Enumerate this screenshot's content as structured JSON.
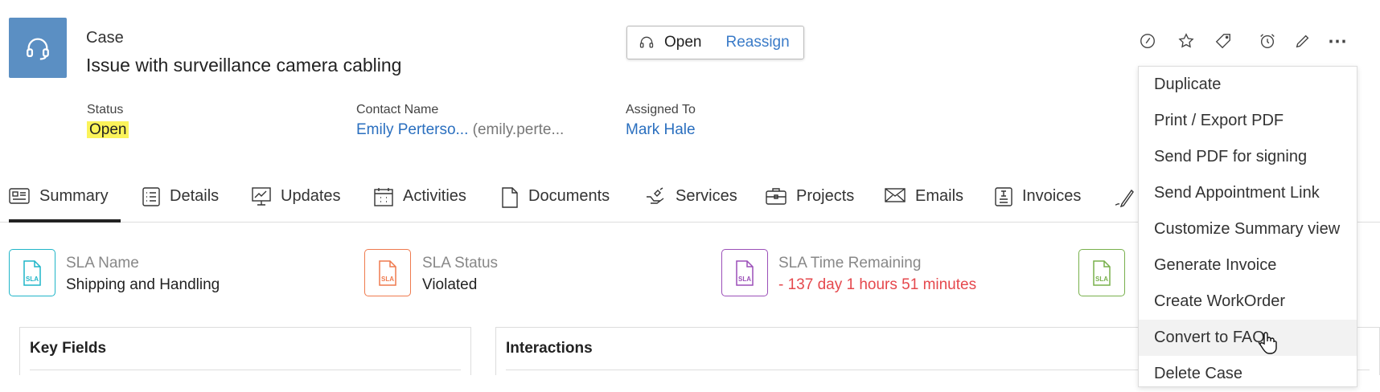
{
  "header": {
    "record_type": "Case",
    "title": "Issue with surveillance camera cabling",
    "status_button": {
      "status": "Open",
      "action": "Reassign"
    }
  },
  "top_icons": [
    "speedometer-icon",
    "star-icon",
    "tag-icon",
    "alarm-clock-icon",
    "pencil-icon",
    "more-icon"
  ],
  "fields": [
    {
      "label": "Status",
      "value": "Open"
    },
    {
      "label": "Contact Name",
      "value": "Emily Perterso...",
      "secondary": "(emily.perte..."
    },
    {
      "label": "Assigned To",
      "value": "Mark Hale"
    }
  ],
  "tabs": [
    {
      "label": "Summary",
      "icon": "summary-card-icon",
      "active": true
    },
    {
      "label": "Details",
      "icon": "list-icon"
    },
    {
      "label": "Updates",
      "icon": "monitor-chart-icon"
    },
    {
      "label": "Activities",
      "icon": "calendar-icon"
    },
    {
      "label": "Documents",
      "icon": "document-icon"
    },
    {
      "label": "Services",
      "icon": "services-icon"
    },
    {
      "label": "Projects",
      "icon": "briefcase-icon"
    },
    {
      "label": "Emails",
      "icon": "envelope-icon"
    },
    {
      "label": "Invoices",
      "icon": "invoice-icon"
    },
    {
      "label": "",
      "icon": "signature-icon"
    }
  ],
  "sla_cards": [
    {
      "label": "SLA Name",
      "value": "Shipping and Handling",
      "color": "#1fb5c8"
    },
    {
      "label": "SLA Status",
      "value": "Violated",
      "color": "#ef7a4e"
    },
    {
      "label": "SLA Time Remaining",
      "value": "- 137 day 1 hours 51 minutes",
      "color": "#9b4fb8",
      "value_color": "#e5484d"
    },
    {
      "label": "",
      "value": "",
      "color": "#78b04c"
    }
  ],
  "sla_icon_text": "SLA",
  "panels": {
    "key_fields": "Key Fields",
    "interactions": "Interactions"
  },
  "menu": {
    "items": [
      "Duplicate",
      "Print / Export PDF",
      "Send PDF for signing",
      "Send Appointment Link",
      "Customize Summary view",
      "Generate Invoice",
      "Create WorkOrder",
      "Convert to FAQ",
      "Delete Case"
    ],
    "hovered": "Convert to FAQ"
  }
}
